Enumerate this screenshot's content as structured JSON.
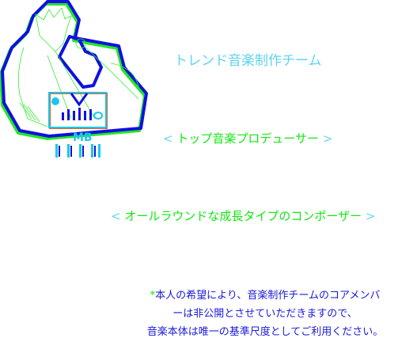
{
  "logo": {
    "name": "logo-illustration",
    "text": "MB"
  },
  "title": "トレンド音楽制作チーム",
  "roles": [
    {
      "open": "<",
      "label": "トップ音楽プロデューサー",
      "close": ">"
    },
    {
      "open": "<",
      "label": "オールラウンドな成長タイプのコンポーザー",
      "close": ">"
    }
  ],
  "note": {
    "asterisk": "*",
    "line1": "本人の希望により、音楽制作チームのコアメンバ",
    "line2": "ーは非公開とさせていただきますので、",
    "line3": "音楽本体は唯一の基準尺度としてご利用ください。"
  },
  "colors": {
    "title": "#5fd4ef",
    "role": "#12e812",
    "note": "#1a1ad8",
    "outline": "#1010e0"
  }
}
